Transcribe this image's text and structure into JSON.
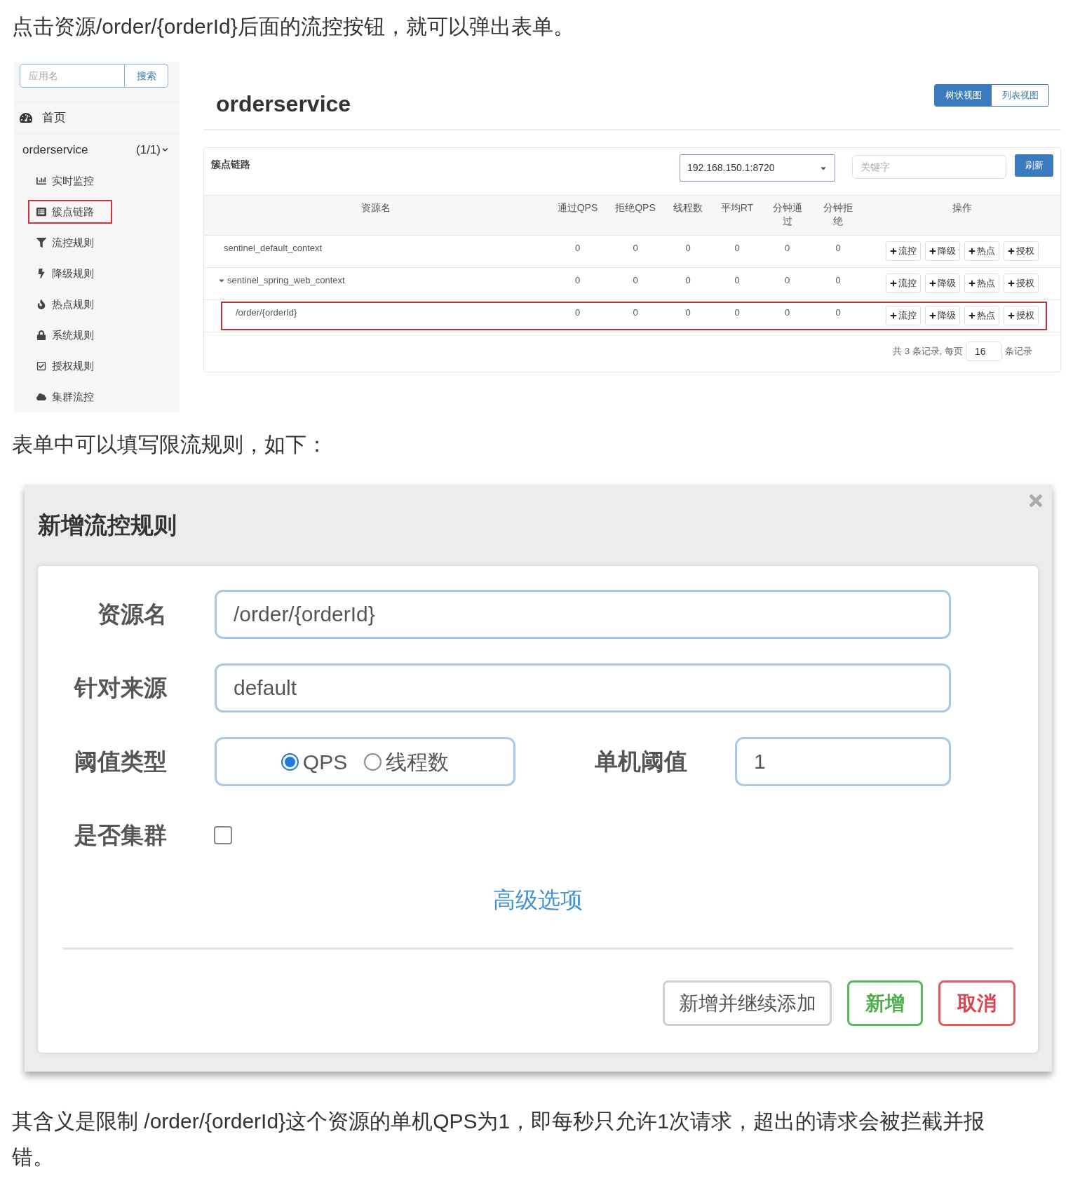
{
  "intro": "点击资源/order/{orderId}后面的流控按钮，就可以弹出表单。",
  "dashboard": {
    "sidebar": {
      "search": {
        "placeholder": "应用名",
        "button": "搜索"
      },
      "home": "首页",
      "app": {
        "name": "orderservice",
        "count": "(1/1)",
        "expanded": true
      },
      "items": [
        {
          "label": "实时监控",
          "highlighted": false
        },
        {
          "label": "簇点链路",
          "highlighted": true
        },
        {
          "label": "流控规则",
          "highlighted": false
        },
        {
          "label": "降级规则",
          "highlighted": false
        },
        {
          "label": "热点规则",
          "highlighted": false
        },
        {
          "label": "系统规则",
          "highlighted": false
        },
        {
          "label": "授权规则",
          "highlighted": false
        },
        {
          "label": "集群流控",
          "highlighted": false
        }
      ]
    },
    "title": "orderservice",
    "views": [
      {
        "label": "树状视图",
        "selected": true
      },
      {
        "label": "列表视图",
        "selected": false
      }
    ],
    "panel": {
      "title": "簇点链路",
      "machine": "192.168.150.1:8720",
      "keyword_placeholder": "关键字",
      "refresh": "刷新",
      "columns": [
        "资源名",
        "通过QPS",
        "拒绝QPS",
        "线程数",
        "平均RT",
        "分钟通过",
        "分钟拒绝",
        "操作"
      ],
      "rows": [
        {
          "name": "sentinel_default_context",
          "values": [
            "0",
            "0",
            "0",
            "0",
            "0",
            "0"
          ],
          "actions": [
            "流控",
            "降级",
            "热点",
            "授权"
          ],
          "highlighted": false
        },
        {
          "name": "sentinel_spring_web_context",
          "values": [
            "0",
            "0",
            "0",
            "0",
            "0",
            "0"
          ],
          "actions": [
            "流控",
            "降级",
            "热点",
            "授权"
          ],
          "highlighted": false,
          "expanded": true,
          "children": [
            {
              "name": "/order/{orderId}",
              "values": [
                "0",
                "0",
                "0",
                "0",
                "0",
                "0"
              ],
              "actions": [
                "流控",
                "降级",
                "热点",
                "授权"
              ],
              "highlighted": true
            }
          ]
        }
      ],
      "footer": {
        "total": "共 3 条记录, 每页",
        "page_size": "16",
        "unit": "条记录"
      }
    }
  },
  "caption": "表单中可以填写限流规则，如下：",
  "dialog": {
    "title": "新增流控规则",
    "fields": [
      {
        "kind": "text",
        "label": "资源名",
        "value": "/order/{orderId}"
      },
      {
        "kind": "text",
        "label": "针对来源",
        "value": "default"
      },
      {
        "kind": "threshold",
        "label": "阈值类型",
        "options": [
          {
            "label": "QPS",
            "selected": true
          },
          {
            "label": "线程数",
            "selected": false
          }
        ],
        "second_label": "单机阈值",
        "value": "1"
      },
      {
        "kind": "checkbox",
        "label": "是否集群",
        "checked": false
      }
    ],
    "advanced": "高级选项",
    "buttons": [
      {
        "kind": "default",
        "label": "新增并继续添加"
      },
      {
        "kind": "success",
        "label": "新增"
      },
      {
        "kind": "danger",
        "label": "取消"
      }
    ]
  },
  "explanation": "其含义是限制 /order/{orderId}这个资源的单机QPS为1，即每秒只允许1次请求，超出的请求会被拦截并报错。"
}
